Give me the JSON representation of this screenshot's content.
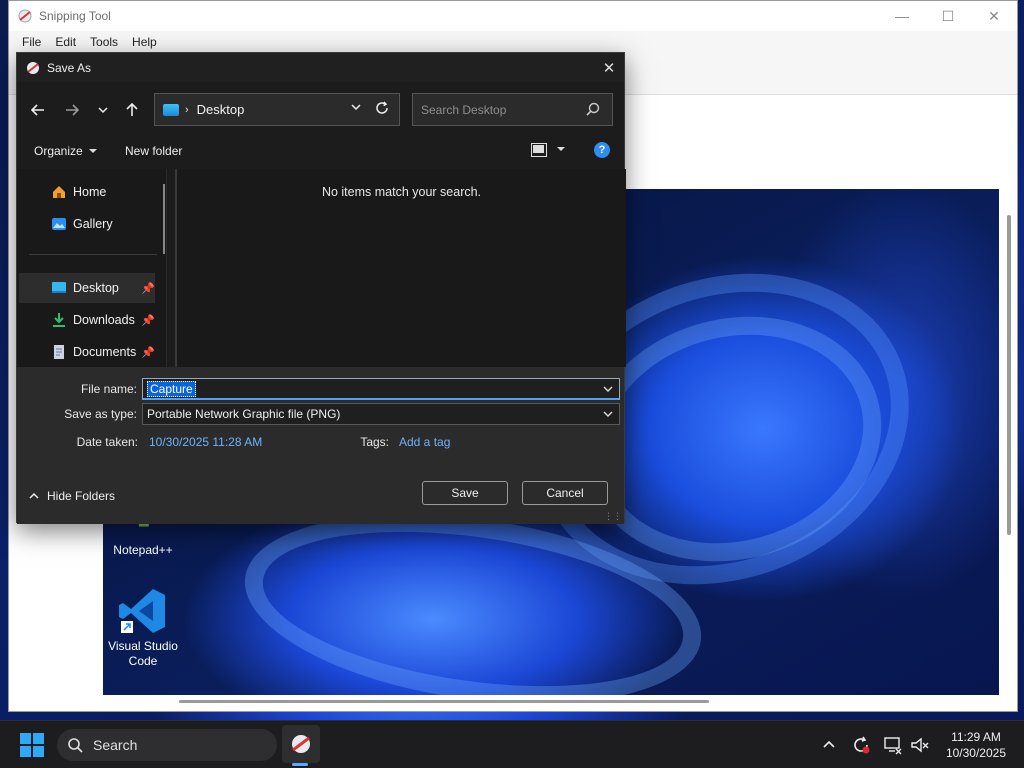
{
  "snipping_tool": {
    "title": "Snipping Tool",
    "menu": [
      "File",
      "Edit",
      "Tools",
      "Help"
    ],
    "desktop_icons": [
      {
        "label": "Notepad++"
      },
      {
        "label": "Visual Studio Code"
      }
    ]
  },
  "dialog": {
    "title": "Save As",
    "address": {
      "location": "Desktop"
    },
    "search": {
      "placeholder": "Search Desktop"
    },
    "commands": {
      "organize": "Organize",
      "new_folder": "New folder"
    },
    "nav_items": [
      {
        "label": "Home",
        "icon": "home-icon",
        "pinned": false
      },
      {
        "label": "Gallery",
        "icon": "gallery-icon",
        "pinned": false
      },
      {
        "label": "Desktop",
        "icon": "desktop-icon",
        "pinned": true,
        "selected": true
      },
      {
        "label": "Downloads",
        "icon": "downloads-icon",
        "pinned": true
      },
      {
        "label": "Documents",
        "icon": "documents-icon",
        "pinned": true
      }
    ],
    "empty_message": "No items match your search.",
    "file_name_label": "File name:",
    "file_name_value": "Capture",
    "save_as_type_label": "Save as type:",
    "save_as_type_value": "Portable Network Graphic file (PNG)",
    "date_taken_label": "Date taken:",
    "date_taken_value": "10/30/2025 11:28 AM",
    "tags_label": "Tags:",
    "tags_value": "Add a tag",
    "hide_folders": "Hide Folders",
    "save_button": "Save",
    "cancel_button": "Cancel"
  },
  "taskbar": {
    "search_label": "Search",
    "time": "11:29 AM",
    "date": "10/30/2025"
  },
  "colors": {
    "accent": "#4aa3ff",
    "link": "#6fb2ff",
    "dialog_bg": "#1c1c1c",
    "selection": "#0a64d8"
  }
}
